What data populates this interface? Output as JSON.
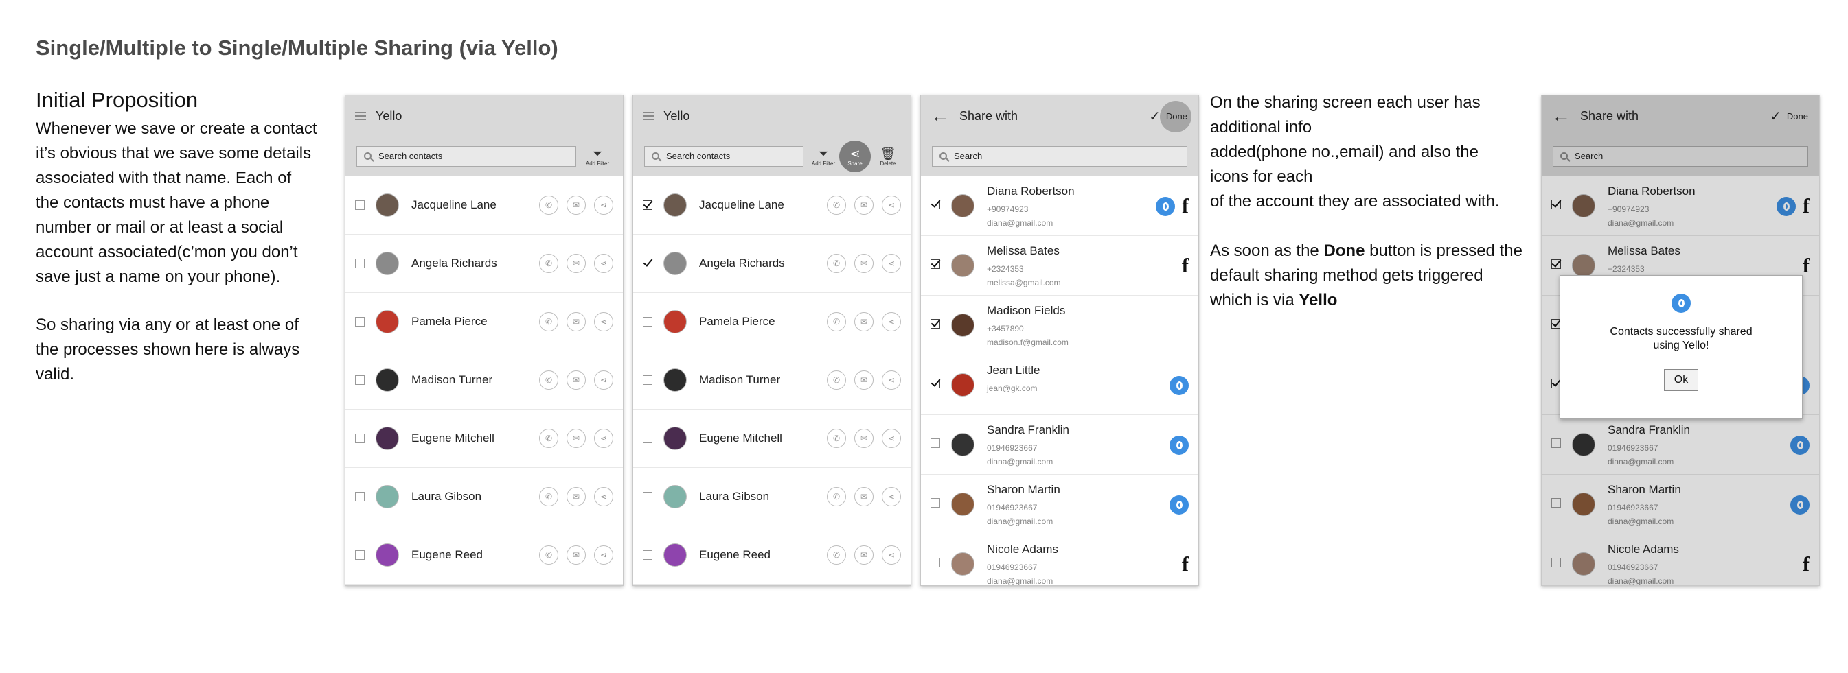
{
  "page_title": "Single/Multiple to Single/Multiple Sharing (via Yello)",
  "intro": {
    "heading": "Initial Proposition",
    "paragraph1": "Whenever we save or create a contact it’s obvious that we save some details associated with that name. Each of the contacts must have a phone number or mail or at least a social account associated(c’mon you don’t save just a name on your phone).",
    "paragraph2": "So sharing via any or at least one of the processes shown here is always valid."
  },
  "description": {
    "para1_lines": [
      "On the sharing screen each user has",
      "additional info",
      "added(phone no.,email) and also the",
      "icons for each",
      "of the account they are associated with."
    ],
    "para2_prefix": "As soon as the ",
    "para2_bold1": "Done",
    "para2_mid": " button is pressed the default sharing method gets triggered which is via ",
    "para2_bold2": "Yello"
  },
  "screen1": {
    "app_title": "Yello",
    "search_placeholder": "Search contacts",
    "add_filter_label": "Add Filter",
    "contacts": [
      {
        "name": "Jacqueline Lane",
        "checked": false,
        "avatar_color": "#6b5a4e"
      },
      {
        "name": "Angela Richards",
        "checked": false,
        "avatar_color": "#8a8a8a"
      },
      {
        "name": "Pamela Pierce",
        "checked": false,
        "avatar_color": "#c0392b"
      },
      {
        "name": "Madison Turner",
        "checked": false,
        "avatar_color": "#2c2c2c"
      },
      {
        "name": "Eugene Mitchell",
        "checked": false,
        "avatar_color": "#4a2c4f"
      },
      {
        "name": "Laura Gibson",
        "checked": false,
        "avatar_color": "#7fb3a8"
      },
      {
        "name": "Eugene Reed",
        "checked": false,
        "avatar_color": "#8e44ad"
      }
    ]
  },
  "screen2": {
    "app_title": "Yello",
    "search_placeholder": "Search contacts",
    "add_filter_label": "Add Filter",
    "share_label": "Share",
    "delete_label": "Delete",
    "contacts": [
      {
        "name": "Jacqueline Lane",
        "checked": true,
        "avatar_color": "#6b5a4e"
      },
      {
        "name": "Angela Richards",
        "checked": true,
        "avatar_color": "#8a8a8a"
      },
      {
        "name": "Pamela Pierce",
        "checked": false,
        "avatar_color": "#c0392b"
      },
      {
        "name": "Madison Turner",
        "checked": false,
        "avatar_color": "#2c2c2c"
      },
      {
        "name": "Eugene Mitchell",
        "checked": false,
        "avatar_color": "#4a2c4f"
      },
      {
        "name": "Laura Gibson",
        "checked": false,
        "avatar_color": "#7fb3a8"
      },
      {
        "name": "Eugene Reed",
        "checked": false,
        "avatar_color": "#8e44ad"
      }
    ]
  },
  "screen3": {
    "title": "Share with",
    "done_label": "Done",
    "search_placeholder": "Search",
    "contacts": [
      {
        "name": "Diana Robertson",
        "line1": "+90974923",
        "line2": "diana@gmail.com",
        "checked": true,
        "yello": true,
        "facebook": true,
        "avatar_color": "#7a5c4a"
      },
      {
        "name": "Melissa Bates",
        "line1": "+2324353",
        "line2": "melissa@gmail.com",
        "checked": true,
        "yello": false,
        "facebook": true,
        "avatar_color": "#9a8070"
      },
      {
        "name": "Madison Fields",
        "line1": "+3457890",
        "line2": "madison.f@gmail.com",
        "checked": true,
        "yello": false,
        "facebook": false,
        "avatar_color": "#5a3a2a"
      },
      {
        "name": "Jean Little",
        "line1": "jean@gk.com",
        "line2": "",
        "checked": true,
        "yello": true,
        "facebook": false,
        "avatar_color": "#b03020"
      },
      {
        "name": "Sandra Franklin",
        "line1": "01946923667",
        "line2": "diana@gmail.com",
        "checked": false,
        "yello": true,
        "facebook": false,
        "avatar_color": "#333333"
      },
      {
        "name": "Sharon Martin",
        "line1": "01946923667",
        "line2": "diana@gmail.com",
        "checked": false,
        "yello": true,
        "facebook": false,
        "avatar_color": "#8a5a3a"
      },
      {
        "name": "Nicole Adams",
        "line1": "01946923667",
        "line2": "diana@gmail.com",
        "checked": false,
        "yello": false,
        "facebook": true,
        "avatar_color": "#a08070"
      }
    ]
  },
  "screen4": {
    "title": "Share with",
    "done_label": "Done",
    "search_placeholder": "Search",
    "dialog_message": "Contacts successfully shared using Yello!",
    "dialog_ok": "Ok"
  },
  "colors": {
    "yello_blue": "#3c8fe2",
    "appbar_gray": "#d9d9d9"
  }
}
